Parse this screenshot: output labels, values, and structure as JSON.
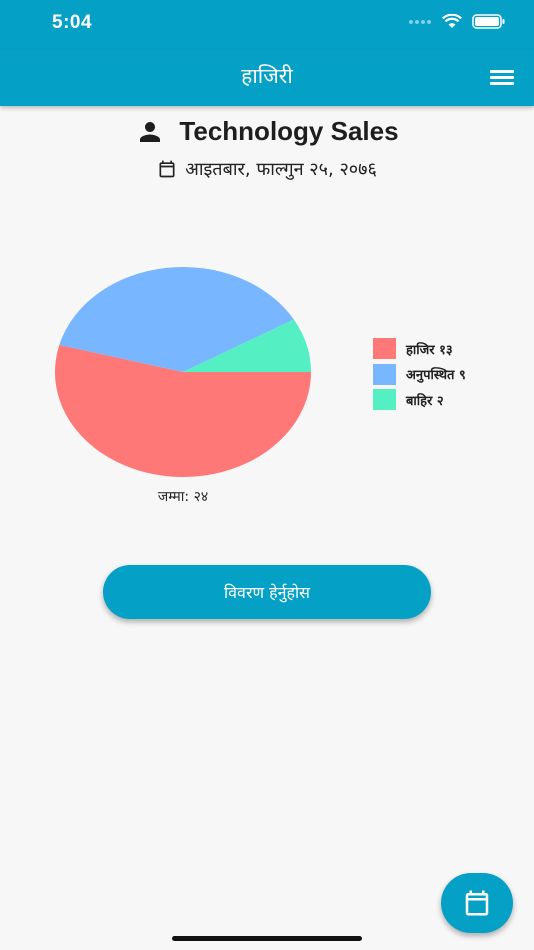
{
  "status_bar": {
    "time": "5:04"
  },
  "appbar": {
    "title": "हाजिरी"
  },
  "header": {
    "team_name": "Technology Sales",
    "date": "आइतबार, फाल्गुन २५, २०७६"
  },
  "chart_data": {
    "type": "pie",
    "slices": [
      {
        "label": "हाजिर १३",
        "value": 13,
        "color": "#ff7878"
      },
      {
        "label": "अनुपस्थित ९",
        "value": 9,
        "color": "#78b6ff"
      },
      {
        "label": "बाहिर २",
        "value": 2,
        "color": "#55efc4"
      }
    ],
    "total_label": "जम्मा: २४",
    "legend_position": "right"
  },
  "actions": {
    "details_button": "विवरण हेर्नुहोस"
  },
  "icons": {
    "person": "person-icon",
    "calendar": "calendar-icon",
    "menu": "menu-icon",
    "fab": "calendar-icon"
  }
}
